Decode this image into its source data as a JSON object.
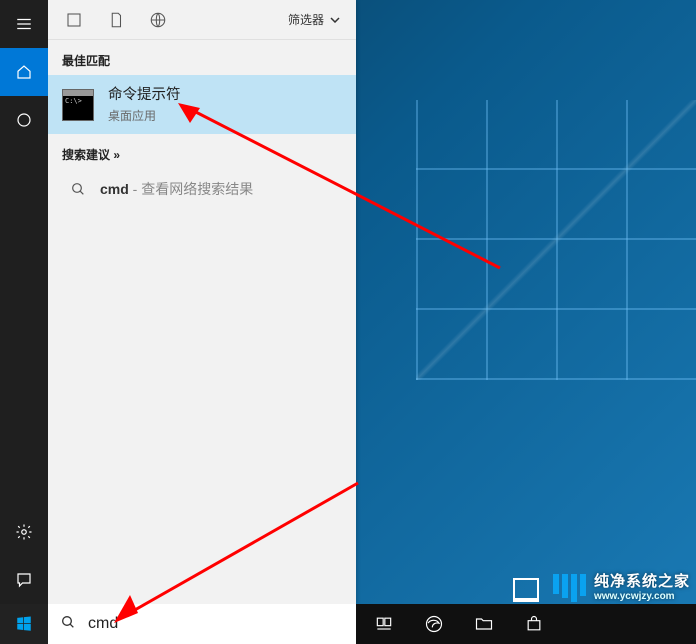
{
  "search_header": {
    "filter_label": "筛选器"
  },
  "sections": {
    "best_match_title": "最佳匹配",
    "suggestions_title": "搜索建议 »"
  },
  "best_match": {
    "title": "命令提示符",
    "subtitle": "桌面应用"
  },
  "suggestions": [
    {
      "bold": "cmd",
      "ext": " - 查看网络搜索结果"
    }
  ],
  "search_box": {
    "value": "cmd"
  },
  "watermark": {
    "line1": "纯净系统之家",
    "line2": "www.ycwjzy.com"
  }
}
